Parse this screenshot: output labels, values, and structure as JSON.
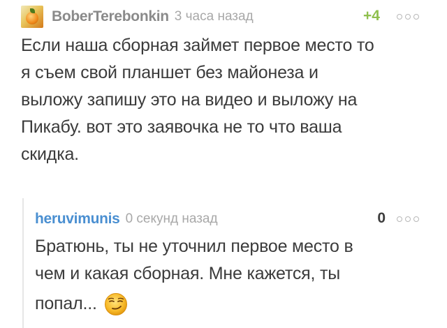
{
  "comment": {
    "username": "BoberTerebonkin",
    "time": "3 часа назад",
    "rating": "+4",
    "text": "Если наша сборная займет первое место то я съем свой планшет без майонеза и выложу запишу это на видео и выложу на Пикабу. вот это заявочка не то что ваша скидка.",
    "text_lines": [
      "Если наша сборная займет первое место то",
      "я съем свой планшет без майонеза и",
      "выложу запишу это на видео и выложу на",
      "Пикабу. вот это заявочка не то что ваша",
      "скидка."
    ],
    "more_icon": "ellipsis-circles-icon"
  },
  "reply": {
    "username": "heruvimunis",
    "time": "0 секунд назад",
    "rating": "0",
    "text_lines": [
      "Братюнь, ты не уточнил первое место в",
      "чем и какая сборная. Мне кажется, ты",
      "попал..."
    ],
    "emoji_icon": "smirking-face-icon",
    "more_icon": "ellipsis-circles-icon"
  },
  "colors": {
    "username_gray": "#8a8a8a",
    "username_blue": "#4a8fd1",
    "rating_green": "#8fbf4d",
    "meta_gray": "#a8a8a8",
    "text": "#3b3b3b"
  }
}
